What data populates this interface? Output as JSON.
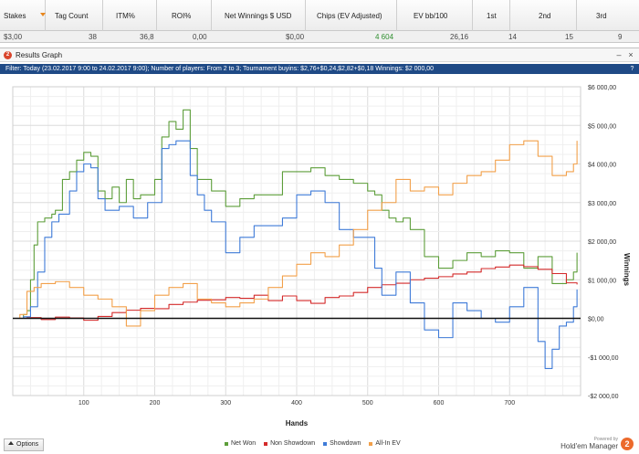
{
  "stats_table": {
    "columns": [
      {
        "key": "stakes",
        "label": "Stakes",
        "value": "$3,00"
      },
      {
        "key": "tag_count",
        "label": "Tag Count",
        "value": "38"
      },
      {
        "key": "itm",
        "label": "ITM%",
        "value": "36,8"
      },
      {
        "key": "roi",
        "label": "ROI%",
        "value": "0,00"
      },
      {
        "key": "net_winnings",
        "label": "Net Winnings $ USD",
        "value": "$0,00"
      },
      {
        "key": "chips_ev",
        "label": "Chips (EV Adjusted)",
        "value": "4 604"
      },
      {
        "key": "ev_bb",
        "label": "EV bb/100",
        "value": "26,16"
      },
      {
        "key": "first",
        "label": "1st",
        "value": "14"
      },
      {
        "key": "second",
        "label": "2nd",
        "value": "15"
      },
      {
        "key": "third",
        "label": "3rd",
        "value": "9"
      }
    ],
    "sort_icon": "sort-desc-icon",
    "highlight_color": "#2f8f2f"
  },
  "window": {
    "title": "Results Graph",
    "app_icon_glyph": "2",
    "minimize_glyph": "–",
    "close_glyph": "×",
    "filter_text": "Filter: Today (23.02.2017 9:00 to 24.02.2017 9:00); Number of players: From 2 to 3; Tournament buyins: $2,76+$0,24,$2,82+$0,18",
    "filter_winnings": "Winnings: $2 000,00",
    "help_glyph": "?"
  },
  "bottom": {
    "options_label": "Options",
    "brand_small": "Powered by",
    "brand_name": "Hold'em Manager",
    "brand_logo_glyph": "2"
  },
  "colors": {
    "net_won": "#5d9e3a",
    "non_showdown": "#d42a2a",
    "showdown": "#3f7bd8",
    "all_in_ev": "#f2a04a",
    "filter_bar": "#1f4a86"
  },
  "chart_data": {
    "type": "line",
    "xlabel": "Hands",
    "ylabel": "Winnings",
    "xlim": [
      0,
      800
    ],
    "ylim": [
      -2000,
      6000
    ],
    "x_ticks": [
      100,
      200,
      300,
      400,
      500,
      600,
      700
    ],
    "y_ticks": [
      {
        "value": 6000,
        "label": "$6 000,00"
      },
      {
        "value": 5000,
        "label": "$5 000,00"
      },
      {
        "value": 4000,
        "label": "$4 000,00"
      },
      {
        "value": 3000,
        "label": "$3 000,00"
      },
      {
        "value": 2000,
        "label": "$2 000,00"
      },
      {
        "value": 1000,
        "label": "$1 000,00"
      },
      {
        "value": 0,
        "label": "$0,00"
      },
      {
        "value": -1000,
        "label": "-$1 000,00"
      },
      {
        "value": -2000,
        "label": "-$2 000,00"
      }
    ],
    "grid": true,
    "legend_position": "bottom-center",
    "series": [
      {
        "name": "Net Won",
        "color": "#5d9e3a",
        "x": [
          0,
          15,
          20,
          25,
          30,
          35,
          45,
          55,
          60,
          70,
          80,
          90,
          100,
          110,
          120,
          130,
          140,
          150,
          160,
          170,
          180,
          200,
          210,
          220,
          230,
          240,
          250,
          260,
          270,
          280,
          300,
          320,
          340,
          360,
          380,
          400,
          420,
          440,
          460,
          480,
          500,
          510,
          520,
          530,
          540,
          550,
          560,
          580,
          600,
          620,
          640,
          660,
          680,
          700,
          720,
          740,
          760,
          780,
          790,
          795
        ],
        "y": [
          0,
          100,
          200,
          1000,
          1900,
          2500,
          2600,
          2700,
          2800,
          3600,
          3800,
          4100,
          4300,
          4200,
          3300,
          3100,
          3400,
          3000,
          3600,
          3100,
          3200,
          3600,
          4700,
          5100,
          4900,
          5400,
          4400,
          3600,
          3600,
          3300,
          2900,
          3100,
          3200,
          3200,
          3800,
          3800,
          3900,
          3700,
          3600,
          3500,
          3300,
          3200,
          2800,
          2600,
          2500,
          2600,
          2300,
          1600,
          1300,
          1500,
          1700,
          1600,
          1750,
          1700,
          1300,
          1600,
          900,
          1000,
          1200,
          1700
        ]
      },
      {
        "name": "Non Showdown",
        "color": "#d42a2a",
        "x": [
          0,
          20,
          40,
          60,
          80,
          100,
          120,
          140,
          160,
          180,
          200,
          220,
          240,
          260,
          280,
          300,
          320,
          340,
          360,
          380,
          400,
          420,
          440,
          460,
          480,
          500,
          520,
          540,
          560,
          580,
          600,
          620,
          640,
          660,
          680,
          700,
          720,
          740,
          760,
          780,
          795
        ],
        "y": [
          0,
          20,
          -30,
          30,
          10,
          -50,
          50,
          150,
          210,
          260,
          250,
          360,
          420,
          470,
          480,
          540,
          520,
          600,
          460,
          580,
          460,
          390,
          540,
          580,
          670,
          800,
          870,
          910,
          1000,
          1040,
          1080,
          1150,
          1200,
          1290,
          1330,
          1380,
          1340,
          1270,
          1160,
          920,
          880
        ]
      },
      {
        "name": "Showdown",
        "color": "#3f7bd8",
        "x": [
          0,
          15,
          25,
          35,
          45,
          55,
          65,
          80,
          90,
          100,
          110,
          120,
          130,
          150,
          170,
          190,
          210,
          220,
          230,
          240,
          250,
          260,
          270,
          280,
          300,
          320,
          340,
          360,
          380,
          400,
          420,
          440,
          460,
          480,
          500,
          510,
          520,
          540,
          560,
          580,
          600,
          620,
          640,
          660,
          680,
          700,
          720,
          740,
          750,
          760,
          770,
          780,
          790,
          795
        ],
        "y": [
          0,
          40,
          300,
          1200,
          2100,
          2500,
          2700,
          3300,
          3800,
          4000,
          3900,
          3100,
          2800,
          2900,
          2600,
          3000,
          4400,
          4500,
          4600,
          4600,
          3700,
          3200,
          2800,
          2500,
          1700,
          2100,
          2400,
          2400,
          2600,
          3200,
          3300,
          3000,
          2300,
          2100,
          2100,
          1300,
          600,
          1200,
          400,
          -300,
          -500,
          400,
          200,
          0,
          -100,
          300,
          800,
          -600,
          -1300,
          -800,
          -200,
          -100,
          300,
          750
        ]
      },
      {
        "name": "All-In EV",
        "color": "#f2a04a",
        "x": [
          0,
          10,
          20,
          30,
          40,
          60,
          80,
          100,
          120,
          140,
          160,
          180,
          200,
          220,
          240,
          260,
          280,
          300,
          320,
          340,
          360,
          380,
          400,
          420,
          440,
          460,
          480,
          500,
          520,
          540,
          560,
          580,
          600,
          620,
          640,
          660,
          680,
          700,
          720,
          740,
          760,
          780,
          790,
          795
        ],
        "y": [
          0,
          100,
          700,
          800,
          900,
          950,
          800,
          600,
          500,
          300,
          -200,
          200,
          600,
          800,
          900,
          500,
          400,
          300,
          400,
          500,
          800,
          1100,
          1400,
          1700,
          1600,
          1900,
          2300,
          2800,
          3000,
          3600,
          3300,
          3400,
          3200,
          3500,
          3700,
          3800,
          4100,
          4500,
          4600,
          4200,
          3700,
          3800,
          4000,
          4600
        ]
      }
    ]
  }
}
